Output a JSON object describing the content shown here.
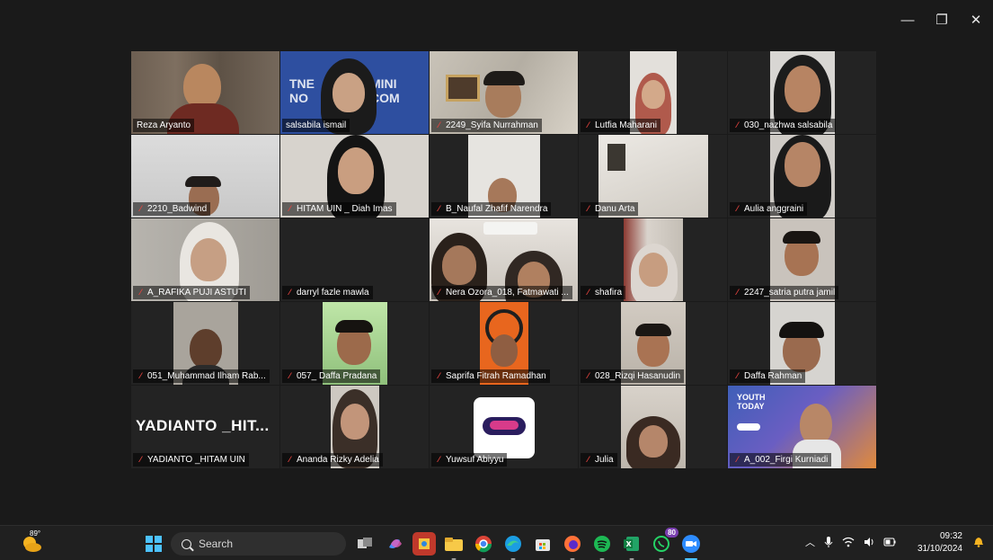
{
  "window": {
    "controls": [
      {
        "name": "minimize-button",
        "glyph": "—"
      },
      {
        "name": "restore-button",
        "glyph": "❐"
      },
      {
        "name": "close-button",
        "glyph": "✕"
      }
    ]
  },
  "participants": [
    {
      "name": "Reza Aryanto",
      "muted": false
    },
    {
      "name": "salsabila ismail",
      "muted": false
    },
    {
      "name": "2249_Syifa Nurrahman",
      "muted": true
    },
    {
      "name": "Lutfia Maharani",
      "muted": true
    },
    {
      "name": "030_nazhwa salsabila",
      "muted": true
    },
    {
      "name": "2210_Badwind",
      "muted": true
    },
    {
      "name": "HITAM UIN _ Diah Imas",
      "muted": true
    },
    {
      "name": "B_Naufal Zhafif Narendra",
      "muted": true
    },
    {
      "name": "Danu Arta",
      "muted": true
    },
    {
      "name": "Aulia anggraini",
      "muted": true
    },
    {
      "name": "A_RAFIKA PUJI ASTUTI",
      "muted": true
    },
    {
      "name": "darryl fazle mawla",
      "muted": true
    },
    {
      "name": "Nera Ozora_018, Fatmawati ...",
      "muted": true
    },
    {
      "name": "shafira",
      "muted": true
    },
    {
      "name": "2247_satria putra jamil",
      "muted": true
    },
    {
      "name": "051_Muhammad Ilham Rab...",
      "muted": true
    },
    {
      "name": "057_ Daffa Pradana",
      "muted": true
    },
    {
      "name": "Saprifa Fitrah Ramadhan",
      "muted": true
    },
    {
      "name": "028_Rizqi Hasanudin",
      "muted": true
    },
    {
      "name": "Daffa Rahman",
      "muted": true
    },
    {
      "name": "YADIANTO _HITAM UIN",
      "muted": true,
      "big_label": "YADIANTO _HIT..."
    },
    {
      "name": "Ananda Rizky Adelia",
      "muted": true
    },
    {
      "name": "Yuwsuf Abiyyu",
      "muted": true
    },
    {
      "name": "Julia",
      "muted": true
    },
    {
      "name": "A_002_Firgi Kurniadi",
      "muted": true
    }
  ],
  "taskbar": {
    "weather_temp": "89°",
    "search_label": "Search",
    "whatsapp_badge": "80",
    "clock_time": "09:32",
    "clock_date": "31/10/2024",
    "apps": [
      "task-view-icon",
      "copilot-icon",
      "photos-icon",
      "file-explorer-icon",
      "chrome-icon",
      "edge-icon",
      "store-icon",
      "firefox-icon",
      "spotify-icon",
      "excel-icon",
      "whatsapp-icon",
      "zoom-icon"
    ],
    "tray": [
      "chevron-up-icon",
      "microphone-icon",
      "wifi-icon",
      "volume-icon",
      "battery-icon"
    ],
    "colors": {
      "accent": "#4cc2ff",
      "active_speaker": "#3ccf5d",
      "muted_icon": "#e5433f"
    }
  }
}
